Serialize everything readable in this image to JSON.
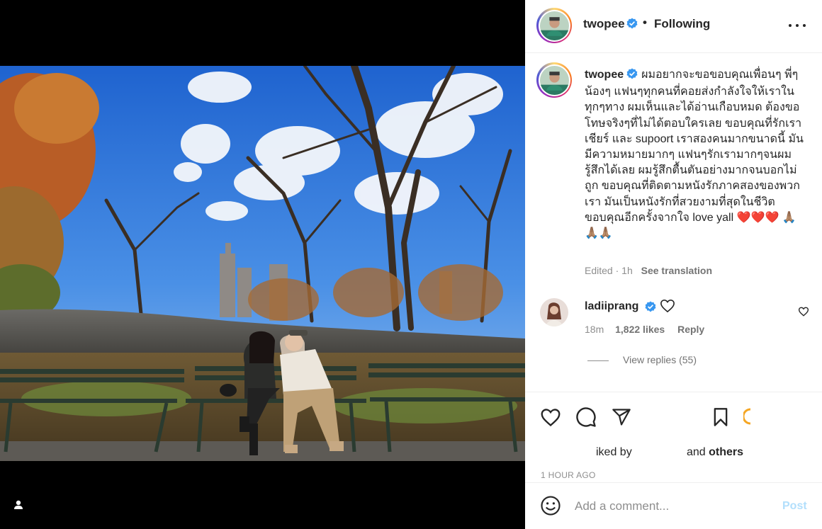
{
  "post": {
    "username": "twopee",
    "follow_status": "Following",
    "caption": "ผมอยากจะขอขอบคุณเพื่อนๆ พี่ๆ น้องๆ แฟนๆทุกคนที่คอยส่งกำลังใจให้เราในทุกๆทาง ผมเห็นและได้อ่านเกือบหมด ต้องขอโทษจริงๆที่ไม่ได้ตอบใครเลย ขอบคุณที่รักเรา เชียร์ และ supoort เราสองคนมากขนาดนี้ มันมีความหมายมากๆ แฟนๆรักเรามากๆจนผมรู้สึกได้เลย ผมรู้สึกตื้นตันอย่างมากจนบอกไม่ถูก ขอบคุณที่ติดตามหนังรักภาคสองของพวกเรา มันเป็นหนังรักที่สวยงามที่สุดในชีวิต ขอบคุณอีกครั้งจากใจ love yall",
    "caption_emoji": "❤️❤️❤️ 🙏🏽🙏🏽🙏🏽",
    "edited_label": "Edited",
    "caption_age": "1h",
    "see_translation": "See translation"
  },
  "comment": {
    "username": "ladiiprang",
    "age": "18m",
    "likes": "1,822 likes",
    "reply_label": "Reply",
    "view_replies": "View replies (55)"
  },
  "actions": {
    "liked_by_fragment": "iked by",
    "and_label": "and",
    "others_label": "others",
    "timestamp": "1 HOUR AGO"
  },
  "comment_box": {
    "placeholder": "Add a comment...",
    "post_label": "Post"
  },
  "colors": {
    "verified": "#3897f0",
    "post_disabled": "#b2dffc",
    "heart_red": "#ed4956"
  },
  "icons": [
    "user-tag-icon",
    "verified-badge-icon",
    "more-options-icon",
    "heart-icon",
    "comment-icon",
    "share-icon",
    "bookmark-icon",
    "emoji-icon"
  ]
}
